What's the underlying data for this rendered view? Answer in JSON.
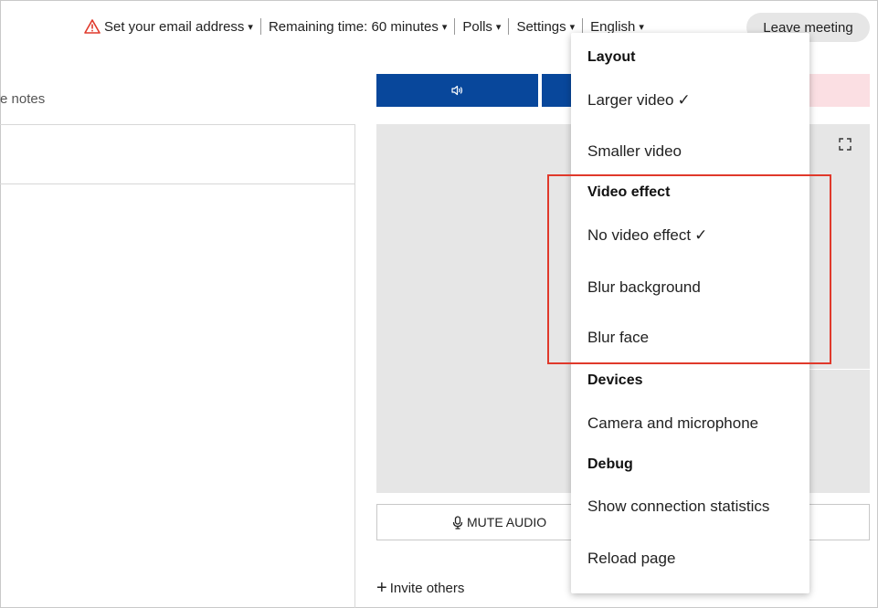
{
  "topbar": {
    "email_label": "Set your email address",
    "remaining_label": "Remaining time: 60 minutes",
    "polls_label": "Polls",
    "settings_label": "Settings",
    "language_label": "English",
    "leave_label": "Leave meeting",
    "caret": "▾"
  },
  "left": {
    "notes_label": "e notes"
  },
  "controls": {
    "mute_audio_label": "MUTE AUDIO",
    "invite_label": "Invite others"
  },
  "settings_menu": {
    "layout_header": "Layout",
    "larger_video": "Larger video",
    "smaller_video": "Smaller video",
    "video_effect_header": "Video effect",
    "no_video_effect": "No video effect",
    "blur_background": "Blur background",
    "blur_face": "Blur face",
    "devices_header": "Devices",
    "camera_and_microphone": "Camera and microphone",
    "debug_header": "Debug",
    "show_connection_statistics": "Show connection statistics",
    "reload_page": "Reload page",
    "check_mark": "✓"
  },
  "colors": {
    "primary_blue": "#08479b",
    "warning_red": "#e0392b",
    "highlight_red": "#e0392b",
    "video_bg": "#e6e6e6"
  },
  "icons": {
    "warning": "warning-triangle-icon",
    "speaker": "speaker-icon",
    "fullscreen": "fullscreen-icon",
    "microphone": "microphone-icon",
    "plus": "plus-icon"
  }
}
